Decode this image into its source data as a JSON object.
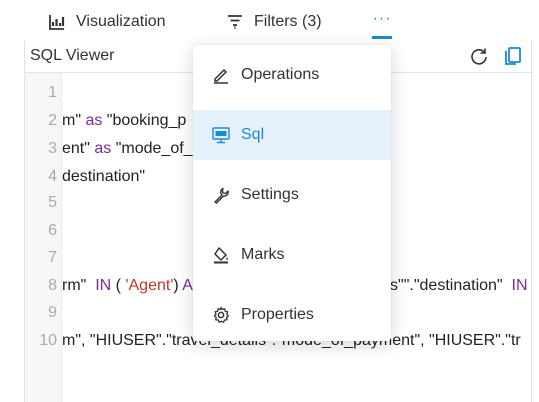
{
  "tabs": [
    {
      "label": "Visualization",
      "icon": "bar-chart-icon"
    },
    {
      "label": "Filters (3)",
      "icon": "filter-icon"
    }
  ],
  "more_label": "···",
  "panel": {
    "title": "SQL Viewer",
    "refresh_icon": "refresh-icon",
    "copy_icon": "copy-icon"
  },
  "line_numbers": [
    "1",
    "2",
    "3",
    "4",
    "5",
    "6",
    "7",
    "8",
    "9",
    "10"
  ],
  "code": {
    "line2": {
      "a": "m\" ",
      "kw": "as",
      "b": " \"booking_p"
    },
    "line3": {
      "a": "ent\" ",
      "kw": "as",
      "b": " \"mode_of_"
    },
    "line4": {
      "a": "destination\""
    },
    "line8": {
      "a": "rm\"  ",
      "kw1": "IN",
      "b": " ( ",
      "s": "'Agent'",
      "c": ") ",
      "kw2": "A",
      "d": "ils\"\".\"destination\"  ",
      "kw3": "IN"
    },
    "line10": {
      "a": "m\", \"HIUSER\".\"travel_details\".\"mode_of_payment\", \"HIUSER\".\"tr"
    }
  },
  "menu": {
    "items": [
      {
        "label": "Operations",
        "icon": "pencil-icon"
      },
      {
        "label": "Sql",
        "icon": "sql-monitor-icon",
        "active": true
      },
      {
        "label": "Settings",
        "icon": "wrench-icon"
      },
      {
        "label": "Marks",
        "icon": "paint-bucket-icon"
      },
      {
        "label": "Properties",
        "icon": "gear-icon"
      }
    ]
  },
  "colors": {
    "accent": "#1a8ad8",
    "active_bg": "#e6f2fb",
    "keyword": "#7a2e9c",
    "string": "#c0392b"
  }
}
